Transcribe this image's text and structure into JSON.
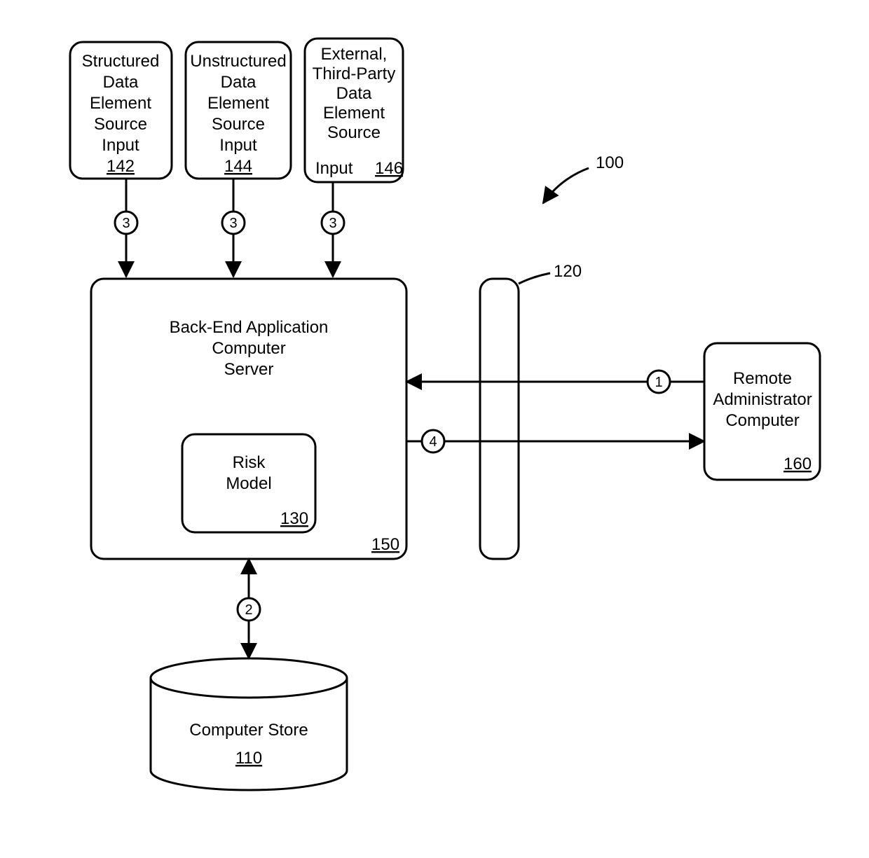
{
  "diagram_ref": {
    "main": "100"
  },
  "inputs": {
    "structured": {
      "l1": "Structured",
      "l2": "Data",
      "l3": "Element",
      "l4": "Source",
      "l5": "Input",
      "ref": "142"
    },
    "unstructured": {
      "l1": "Unstructured",
      "l2": "Data",
      "l3": "Element",
      "l4": "Source",
      "l5": "Input",
      "ref": "144"
    },
    "external": {
      "l1": "External,",
      "l2": "Third-Party",
      "l3": "Data",
      "l4": "Element",
      "l5": "Source",
      "l6": "Input",
      "ref": "146"
    }
  },
  "server": {
    "l1": "Back-End Application",
    "l2": "Computer",
    "l3": "Server",
    "ref": "150",
    "risk": {
      "l1": "Risk",
      "l2": "Model",
      "ref": "130"
    }
  },
  "firewall": {
    "ref": "120"
  },
  "remote": {
    "l1": "Remote",
    "l2": "Administrator",
    "l3": "Computer",
    "ref": "160"
  },
  "store": {
    "l1": "Computer Store",
    "ref": "110"
  },
  "flow": {
    "in_structured": "3",
    "in_unstructured": "3",
    "in_external": "3",
    "from_remote": "1",
    "to_remote": "4",
    "to_store": "2"
  }
}
